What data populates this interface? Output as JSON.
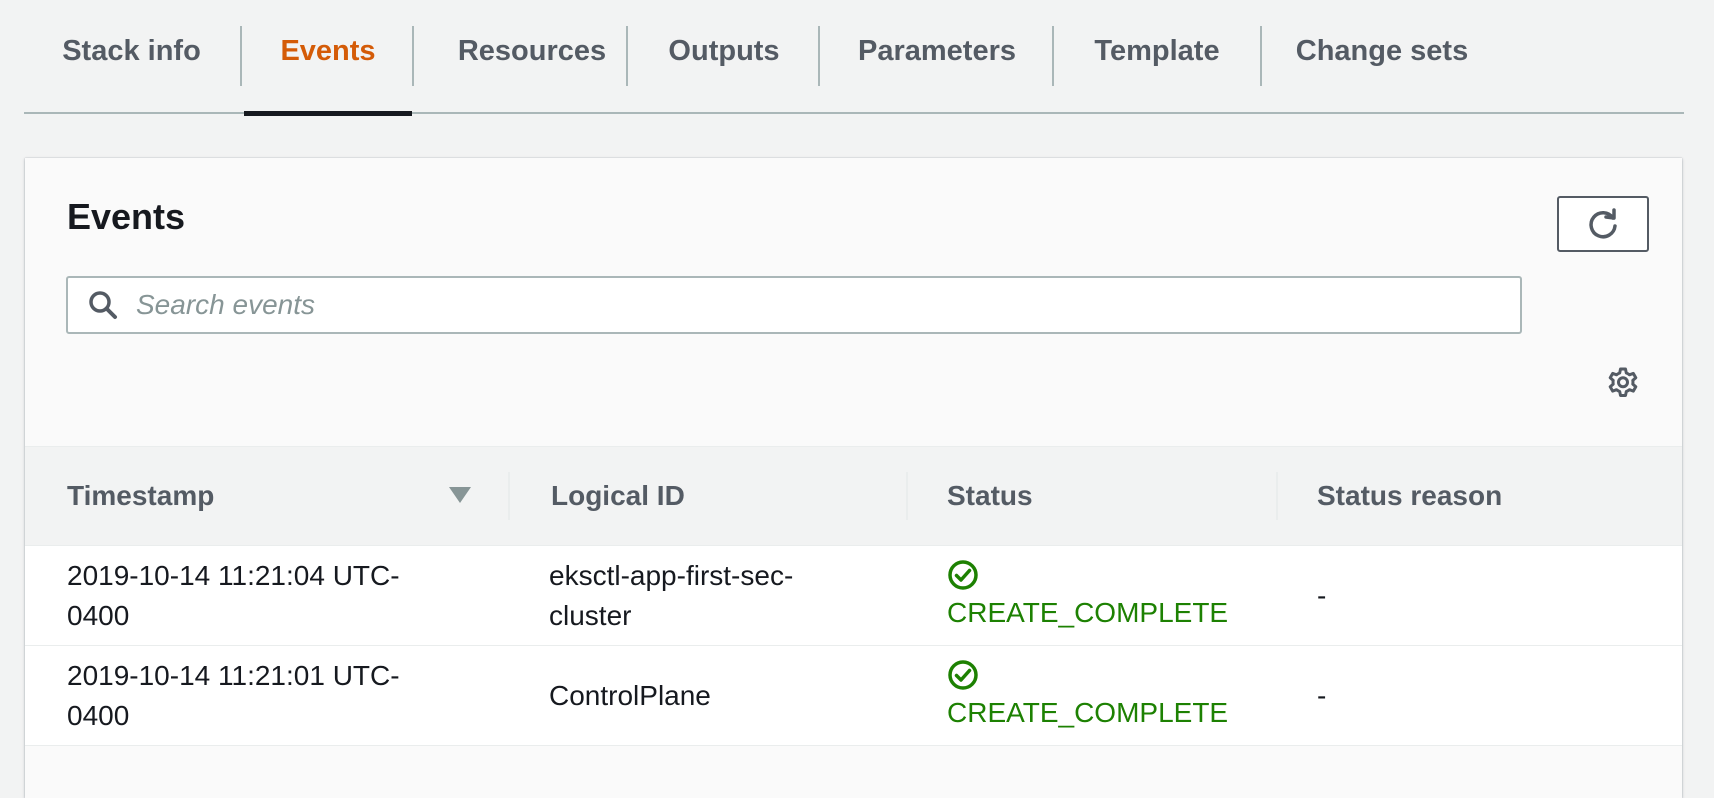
{
  "tabs": [
    {
      "label": "Stack info"
    },
    {
      "label": "Events"
    },
    {
      "label": "Resources"
    },
    {
      "label": "Outputs"
    },
    {
      "label": "Parameters"
    },
    {
      "label": "Template"
    },
    {
      "label": "Change sets"
    }
  ],
  "active_tab": "Events",
  "panel": {
    "title": "Events",
    "search_placeholder": "Search events",
    "refresh_icon": "refresh-icon",
    "settings_icon": "gear-icon"
  },
  "table": {
    "columns": [
      "Timestamp",
      "Logical ID",
      "Status",
      "Status reason"
    ],
    "sort": {
      "column": "Timestamp",
      "direction": "descending"
    },
    "rows": [
      {
        "timestamp_line1": "2019-10-14 11:21:04 UTC-",
        "timestamp_line2": "0400",
        "logical_id_line1": "eksctl-app-first-sec-",
        "logical_id_line2": "cluster",
        "status": "CREATE_COMPLETE",
        "status_reason": "-"
      },
      {
        "timestamp_line1": "2019-10-14 11:21:01 UTC-",
        "timestamp_line2": "0400",
        "logical_id_line1": "ControlPlane",
        "logical_id_line2": "",
        "status": "CREATE_COMPLETE",
        "status_reason": "-"
      }
    ]
  },
  "colors": {
    "active_tab": "#d45b07",
    "status_success": "#1d8102"
  }
}
